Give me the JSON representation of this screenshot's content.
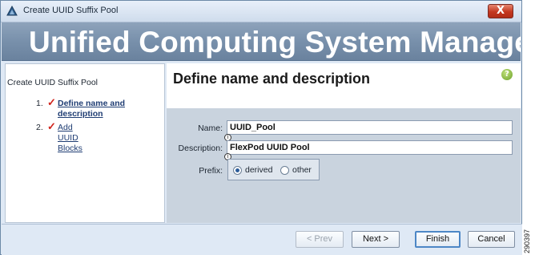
{
  "window": {
    "title": "Create UUID Suffix Pool",
    "close_label": "X"
  },
  "banner": {
    "text": "Unified Computing System Manager"
  },
  "sidebar": {
    "title": "Create UUID Suffix Pool",
    "steps": [
      {
        "number": "1.",
        "label": "Define name and description",
        "done": true,
        "current": true
      },
      {
        "number": "2.",
        "label": "Add UUID Blocks",
        "done": true,
        "current": false
      }
    ]
  },
  "content": {
    "title": "Define name and description",
    "help_icon": "help-icon"
  },
  "form": {
    "name_label": "Name:",
    "name_value": "UUID_Pool",
    "description_label": "Description:",
    "description_value": "FlexPod UUID Pool",
    "prefix_label": "Prefix:",
    "prefix_options": [
      "derived",
      "other"
    ],
    "prefix_selected": "derived"
  },
  "buttons": {
    "prev": "< Prev",
    "next": "Next >",
    "finish": "Finish",
    "cancel": "Cancel"
  },
  "image_id": "290397",
  "colors": {
    "banner": "#7890ab",
    "link": "#1f3d73",
    "check": "#d0231b"
  }
}
